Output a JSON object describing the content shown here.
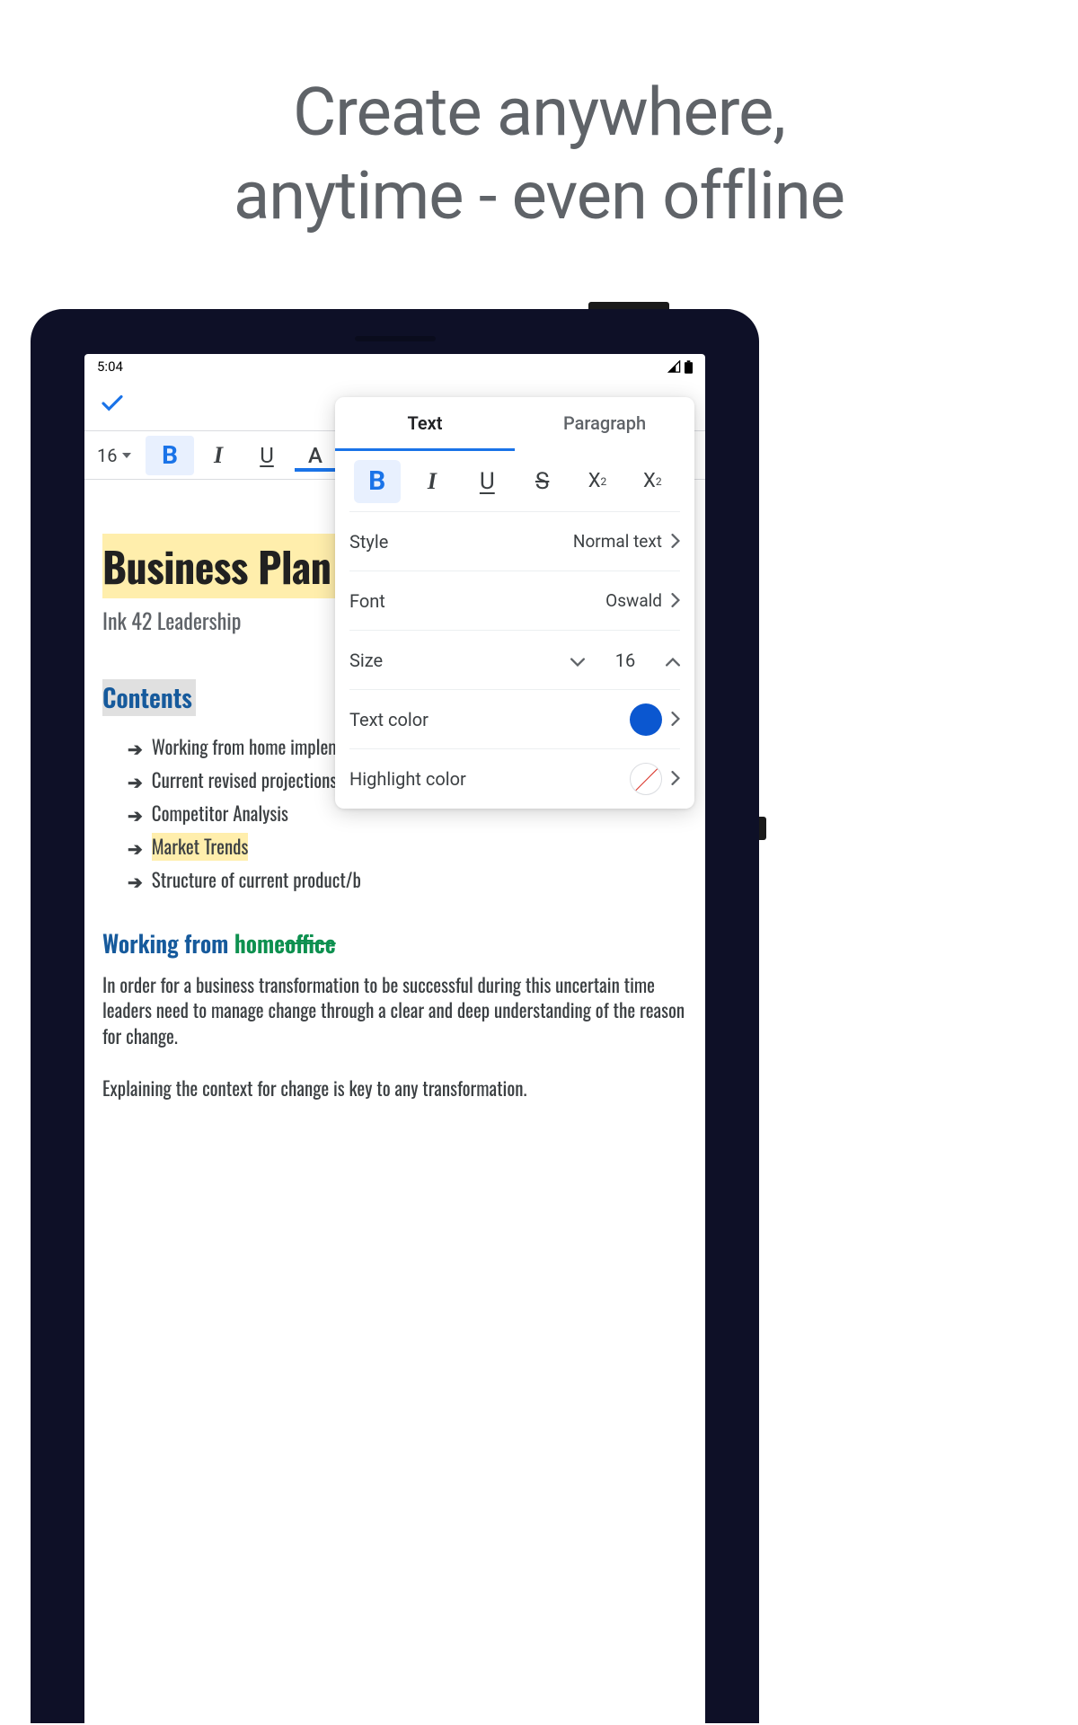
{
  "headline": {
    "line1": "Create anywhere,",
    "line2": "anytime - even offline"
  },
  "status": {
    "time": "5:04"
  },
  "toolbar": {
    "size": "16",
    "bold": "B",
    "italic": "I",
    "underline": "U",
    "color_a": "A"
  },
  "doc": {
    "title": "Business Plan",
    "subtitle": "Ink 42 Leadership",
    "contents_heading": "Contents",
    "contents": [
      "Working from home implemen",
      "Current revised projections",
      "Competitor Analysis",
      "Market Trends",
      "Structure of current product/b"
    ],
    "highlight_index": 3,
    "section_heading_prefix": "Working from ",
    "section_heading_home": "home",
    "section_heading_strike": "office",
    "para1": "In order for a business transformation to be successful during this uncertain time leaders need to manage change through a clear and deep understanding of the reason for change.",
    "para2": "Explaining the context for change is key to any transformation."
  },
  "popup": {
    "tabs": {
      "text": "Text",
      "paragraph": "Paragraph"
    },
    "format": {
      "bold": "B",
      "italic": "I",
      "underline": "U",
      "strike": "S",
      "sup": "X",
      "sub": "X"
    },
    "rows": {
      "style": {
        "label": "Style",
        "value": "Normal text"
      },
      "font": {
        "label": "Font",
        "value": "Oswald"
      },
      "size": {
        "label": "Size",
        "value": "16"
      },
      "text_color": {
        "label": "Text color",
        "hex": "#0b57d0"
      },
      "highlight_color": {
        "label": "Highlight color",
        "value": "none"
      }
    }
  }
}
